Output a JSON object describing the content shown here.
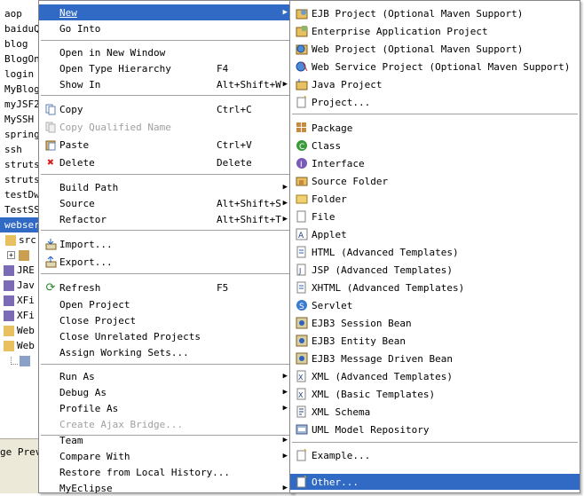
{
  "tree": {
    "items": [
      {
        "label": "aop",
        "selected": false
      },
      {
        "label": "baiduQ",
        "selected": false
      },
      {
        "label": "blog",
        "selected": false
      },
      {
        "label": "BlogOn",
        "selected": false
      },
      {
        "label": "login",
        "selected": false
      },
      {
        "label": "MyBlog",
        "selected": false
      },
      {
        "label": "myJSF2",
        "selected": false
      },
      {
        "label": "MySSH",
        "selected": false
      },
      {
        "label": "spring",
        "selected": false
      },
      {
        "label": "ssh",
        "selected": false
      },
      {
        "label": "struts",
        "selected": false
      },
      {
        "label": "struts",
        "selected": false
      },
      {
        "label": "testDw",
        "selected": false
      },
      {
        "label": "TestSS",
        "selected": false
      },
      {
        "label": "webser",
        "selected": true
      },
      {
        "label": "src",
        "selected": false
      },
      {
        "label": "",
        "selected": false
      },
      {
        "label": "JRE",
        "selected": false
      },
      {
        "label": "Jav",
        "selected": false
      },
      {
        "label": "XFi",
        "selected": false
      },
      {
        "label": "XFi",
        "selected": false
      },
      {
        "label": "Web",
        "selected": false
      },
      {
        "label": "Web",
        "selected": false
      }
    ],
    "bottom_label": "ge Prev"
  },
  "main_menu": {
    "new": "New",
    "go_into": "Go Into",
    "open_new_window": "Open in New Window",
    "open_type_hierarchy": "Open Type Hierarchy",
    "open_type_hierarchy_sc": "F4",
    "show_in": "Show In",
    "show_in_sc": "Alt+Shift+W",
    "copy": "Copy",
    "copy_sc": "Ctrl+C",
    "copy_qualified": "Copy Qualified Name",
    "paste": "Paste",
    "paste_sc": "Ctrl+V",
    "delete": "Delete",
    "delete_sc": "Delete",
    "build_path": "Build Path",
    "source": "Source",
    "source_sc": "Alt+Shift+S",
    "refactor": "Refactor",
    "refactor_sc": "Alt+Shift+T",
    "import": "Import...",
    "export": "Export...",
    "refresh": "Refresh",
    "refresh_sc": "F5",
    "open_project": "Open Project",
    "close_project": "Close Project",
    "close_unrelated": "Close Unrelated Projects",
    "assign_working_sets": "Assign Working Sets...",
    "run_as": "Run As",
    "debug_as": "Debug As",
    "profile_as": "Profile As",
    "create_ajax_bridge": "Create Ajax Bridge...",
    "team": "Team",
    "compare_with": "Compare With",
    "restore_history": "Restore from Local History...",
    "myeclipse": "MyEclipse"
  },
  "sub_menu": {
    "ejb_project": "EJB Project (Optional Maven Support)",
    "enterprise_app": "Enterprise Application Project",
    "web_project": "Web Project (Optional Maven Support)",
    "web_service_project": "Web Service Project (Optional Maven Support)",
    "java_project": "Java Project",
    "project": "Project...",
    "package": "Package",
    "class": "Class",
    "interface": "Interface",
    "source_folder": "Source Folder",
    "folder": "Folder",
    "file": "File",
    "applet": "Applet",
    "html": "HTML (Advanced Templates)",
    "jsp": "JSP (Advanced Templates)",
    "xhtml": "XHTML (Advanced Templates)",
    "servlet": "Servlet",
    "ejb3_session": "EJB3 Session Bean",
    "ejb3_entity": "EJB3 Entity Bean",
    "ejb3_mdb": "EJB3 Message Driven Bean",
    "xml_adv": "XML (Advanced Templates)",
    "xml_basic": "XML (Basic Templates)",
    "xml_schema": "XML Schema",
    "uml_repo": "UML Model Repository",
    "example": "Example...",
    "other": "Other..."
  },
  "colors": {
    "highlight": "#316ac5",
    "disabled": "#a0a0a0",
    "delete_red": "#d42020",
    "java_green": "#3c9a3c",
    "package_brown": "#b07a30"
  }
}
